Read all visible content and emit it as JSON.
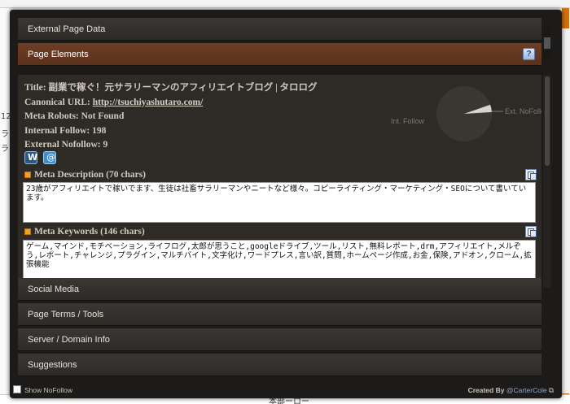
{
  "background": {
    "left_fragments": [
      "12",
      "ラ",
      "ラ"
    ],
    "bottom_text": "本部ーロー"
  },
  "sections": {
    "external": "External Page Data",
    "page_elements": "Page Elements",
    "help": "?",
    "social": "Social Media",
    "terms": "Page Terms / Tools",
    "server": "Server / Domain Info",
    "suggestions": "Suggestions"
  },
  "page_info": {
    "title_label": "Title:",
    "title_value": "副業で稼ぐ！元サラリーマンのアフィリエイトブログ | タロログ",
    "canonical_label": "Canonical URL:",
    "canonical_value": "http://tsuchiyashutaro.com/",
    "robots_label": "Meta Robots:",
    "robots_value": "Not Found",
    "internal_label": "Internal Follow:",
    "internal_value": "198",
    "external_label": "External Nofollow:",
    "external_value": "9"
  },
  "chart_data": {
    "type": "pie",
    "categories": [
      "Int. Follow",
      "Ext. NoFollo"
    ],
    "values": [
      198,
      9
    ],
    "colors": [
      "#3a3733",
      "#d8d4cc"
    ]
  },
  "icons": [
    "wordpress-icon",
    "bird-icon"
  ],
  "meta_description": {
    "title": "Meta Description (70 chars)",
    "text": "23歳がアフィリエイトで稼いでます、生徒は社畜サラリーマンやニートなど様々。コピーライティング・マーケティング・SEOについて書いています。"
  },
  "meta_keywords": {
    "title": "Meta Keywords (146 chars)",
    "text": "ゲーム,マインド,モチベーション,ライフログ,太郎が思うこと,googleドライブ,ツール,リスト,無料レポート,drm,アフィリエイト,メルぞう,レポート,チャレンジ,プラグイン,マルチバイト,文字化け,ワードプレス,言い訳,質問,ホームページ作成,お金,保険,アドオン,クローム,拡張機能"
  },
  "footer": {
    "show_nofollow": "Show NoFollow",
    "created_by": "Created By",
    "author": "@CarterCole"
  }
}
